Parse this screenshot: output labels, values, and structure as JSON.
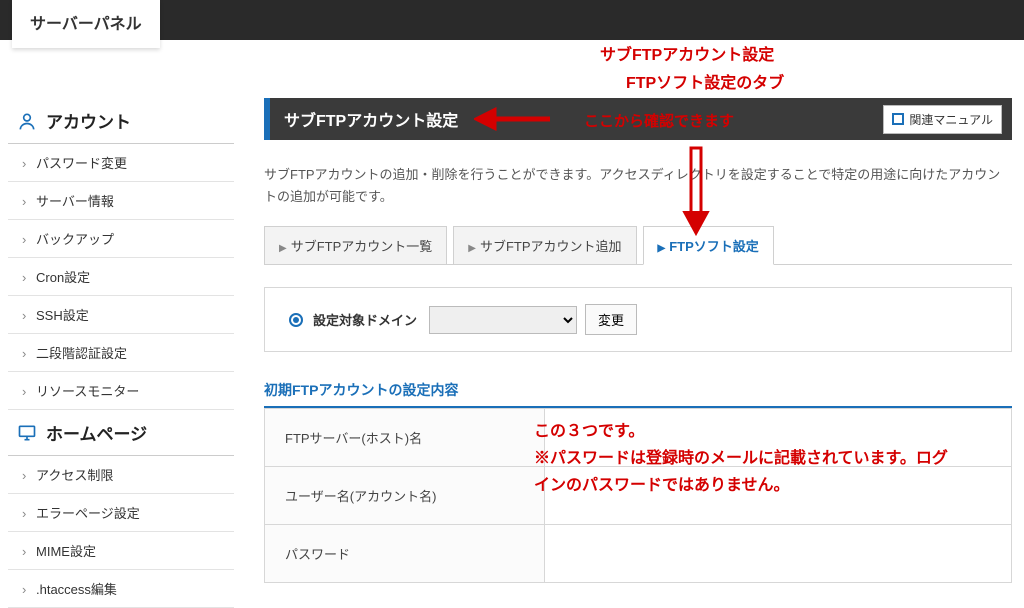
{
  "colors": {
    "accent": "#1a6fb8",
    "anno": "#d40000",
    "header_bg": "#3a3a3a"
  },
  "logo": "サーバーパネル",
  "anno_top1": "サブFTPアカウント設定",
  "anno_top2": "FTPソフト設定のタブ",
  "anno_header": "ここから確認できます",
  "anno_body": "この３つです。\n※パスワードは登録時のメールに記載されています。ログインのパスワードではありません。",
  "sidebar": {
    "section1": {
      "title": "アカウント",
      "icon": "user"
    },
    "items1": [
      "パスワード変更",
      "サーバー情報",
      "バックアップ",
      "Cron設定",
      "SSH設定",
      "二段階認証設定",
      "リソースモニター"
    ],
    "section2": {
      "title": "ホームページ",
      "icon": "monitor"
    },
    "items2": [
      "アクセス制限",
      "エラーページ設定",
      "MIME設定",
      ".htaccess編集"
    ]
  },
  "header": {
    "title": "サブFTPアカウント設定",
    "manual": "関連マニュアル"
  },
  "desc": "サブFTPアカウントの追加・削除を行うことができます。アクセスディレクトリを設定することで特定の用途に向けたアカウントの追加が可能です。",
  "tabs": {
    "list": "サブFTPアカウント一覧",
    "add": "サブFTPアカウント追加",
    "soft": "FTPソフト設定"
  },
  "domain": {
    "label": "設定対象ドメイン",
    "change": "変更",
    "value": ""
  },
  "section_title": "初期FTPアカウントの設定内容",
  "table": {
    "row1": "FTPサーバー(ホスト)名",
    "row2": "ユーザー名(アカウント名)",
    "row3": "パスワード",
    "val1": "",
    "val2": "",
    "val3": ""
  }
}
